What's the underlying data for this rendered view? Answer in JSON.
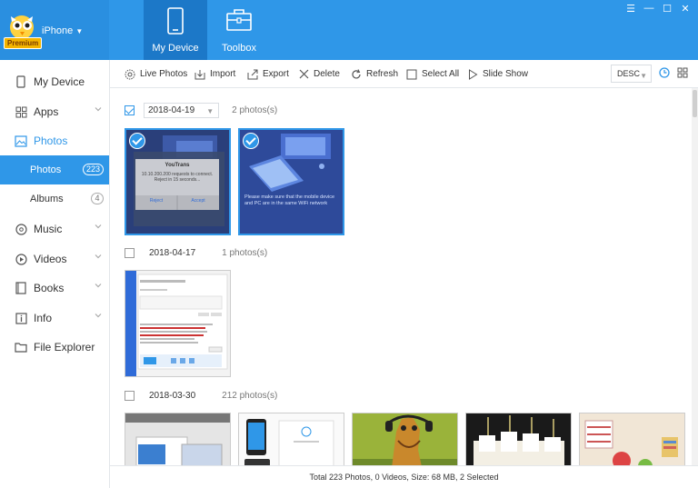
{
  "device": {
    "name": "iPhone",
    "premium_label": "Premium"
  },
  "top_tabs": [
    {
      "label": "My Device",
      "icon": "phone-icon",
      "active": true
    },
    {
      "label": "Toolbox",
      "icon": "toolbox-icon",
      "active": false
    }
  ],
  "window_controls": [
    "menu-icon",
    "minimize-icon",
    "maximize-icon",
    "close-icon"
  ],
  "sidebar": {
    "items": [
      {
        "label": "My Device",
        "icon": "phone-icon"
      },
      {
        "label": "Apps",
        "icon": "apps-grid-icon"
      },
      {
        "label": "Photos",
        "icon": "image-icon"
      },
      {
        "label": "Photos",
        "badge": "223"
      },
      {
        "label": "Albums",
        "badge": "4"
      },
      {
        "label": "Music",
        "icon": "music-disc-icon"
      },
      {
        "label": "Videos",
        "icon": "play-circle-icon"
      },
      {
        "label": "Books",
        "icon": "book-icon"
      },
      {
        "label": "Info",
        "icon": "info-icon"
      },
      {
        "label": "File Explorer",
        "icon": "folder-icon"
      }
    ]
  },
  "toolbar": {
    "live_photos": "Live Photos",
    "import": "Import",
    "export": "Export",
    "delete": "Delete",
    "refresh": "Refresh",
    "select_all": "Select All",
    "slide_show": "Slide Show",
    "sort": "DESC"
  },
  "groups": [
    {
      "date": "2018-04-19",
      "count": "2 photos(s)",
      "checked": true
    },
    {
      "date": "2018-04-17",
      "count": "1 photos(s)",
      "checked": false
    },
    {
      "date": "2018-03-30",
      "count": "212 photos(s)",
      "checked": false
    }
  ],
  "thumbs": {
    "t1_dialog_title": "YouTrans",
    "t1_dialog_body": "10.10.200.200 requests to connect. Reject in 15 seconds...",
    "t1_reject": "Reject",
    "t1_accept": "Accept",
    "t2_text": "Please make sure that the mobile device and PC are in the same WiFi network"
  },
  "status": "Total 223 Photos, 0 Videos, Size: 68 MB, 2 Selected",
  "colors": {
    "accent": "#2f97e8",
    "topbar": "#2f97e8",
    "active_tab": "#1c78c8"
  }
}
